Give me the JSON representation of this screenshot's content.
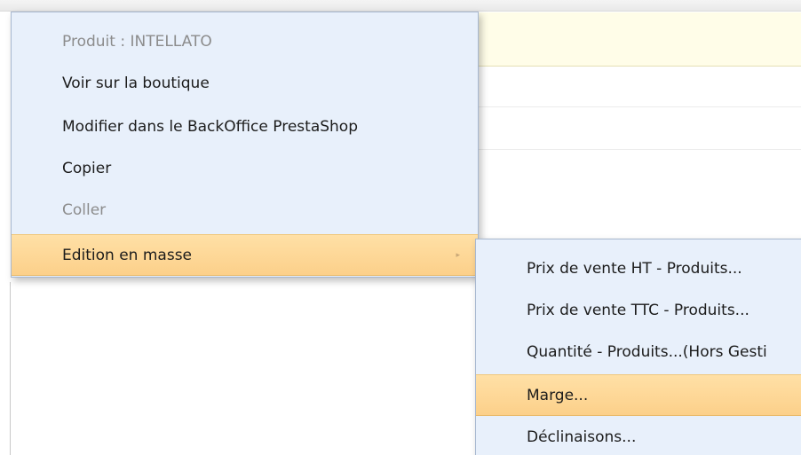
{
  "main_menu": {
    "items": [
      {
        "label": "Produit : INTELLATO",
        "disabled": true
      },
      {
        "label": "Voir sur la boutique"
      },
      {
        "label": "Modifier dans le BackOffice PrestaShop"
      },
      {
        "label": "Copier"
      },
      {
        "label": "Coller",
        "disabled": true
      },
      {
        "label": "Edition en masse",
        "highlighted": true,
        "submenu_arrow": "▸"
      }
    ]
  },
  "sub_menu": {
    "items": [
      {
        "label": "Prix de vente HT - Produits..."
      },
      {
        "label": "Prix de vente TTC - Produits..."
      },
      {
        "label": "Quantité - Produits...(Hors Gesti"
      },
      {
        "label": "Marge...",
        "highlighted": true
      },
      {
        "label": "Déclinaisons..."
      }
    ]
  },
  "colors": {
    "menu_bg": "#e8f0fb",
    "menu_border": "#a7b7cf",
    "highlight_bg": "#fcd08a",
    "disabled_text": "#8c8c8c"
  }
}
